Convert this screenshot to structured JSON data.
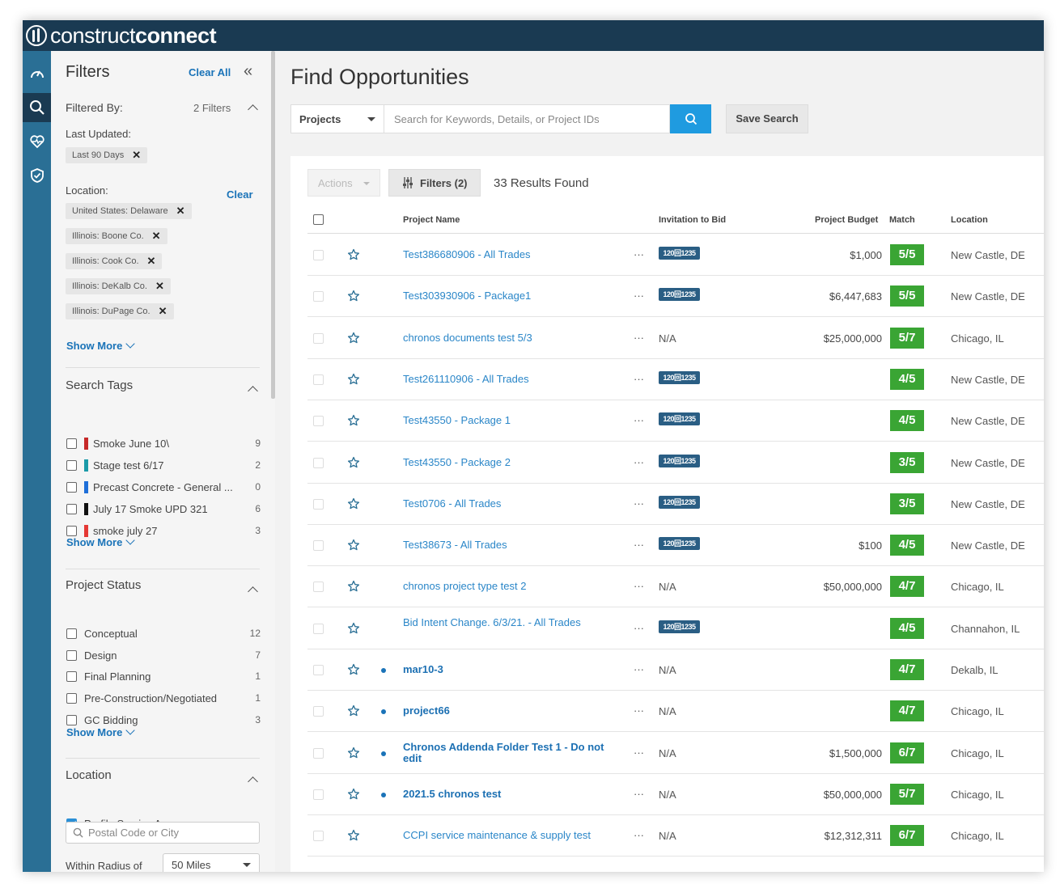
{
  "brand": {
    "part1": "construct",
    "part2": "connect"
  },
  "colors": {
    "topbar": "#1a3a52",
    "rail": "#2a6f95",
    "accent": "#1f9be0",
    "match": "#3aa534",
    "link": "#2a86c8"
  },
  "rail": [
    "dashboard-icon",
    "search-icon",
    "heart-pulse-icon",
    "shield-check-icon"
  ],
  "filters": {
    "title": "Filters",
    "clear_all": "Clear All",
    "filtered_by": "Filtered By:",
    "filter_count": "2 Filters",
    "last_updated_label": "Last Updated:",
    "last_updated_chip": "Last 90 Days",
    "location_label": "Location:",
    "location_clear": "Clear",
    "location_chips": [
      "United States: Delaware",
      "Illinois: Boone Co.",
      "Illinois: Cook Co.",
      "Illinois: DeKalb Co.",
      "Illinois: DuPage Co."
    ],
    "show_more": "Show More",
    "search_tags": {
      "title": "Search Tags",
      "items": [
        {
          "label": "Smoke June 10\\",
          "count": "9",
          "color": "#c62828"
        },
        {
          "label": "Stage test 6/17",
          "count": "2",
          "color": "#1a9aa8"
        },
        {
          "label": "Precast Concrete - General ...",
          "count": "0",
          "color": "#1e6fd9"
        },
        {
          "label": "July 17 Smoke UPD 321",
          "count": "6",
          "color": "#111111"
        },
        {
          "label": "smoke july 27",
          "count": "3",
          "color": "#e53935"
        }
      ]
    },
    "project_status": {
      "title": "Project Status",
      "items": [
        {
          "label": "Conceptual",
          "count": "12"
        },
        {
          "label": "Design",
          "count": "7"
        },
        {
          "label": "Final Planning",
          "count": "1"
        },
        {
          "label": "Pre-Construction/Negotiated",
          "count": "1"
        },
        {
          "label": "GC Bidding",
          "count": "3"
        }
      ]
    },
    "location_section": {
      "title": "Location",
      "profile_service_area": "Profile Service Area",
      "postal_placeholder": "Postal Code or City",
      "radius_label": "Within Radius of",
      "radius_value": "50 Miles"
    }
  },
  "main": {
    "title": "Find Opportunities",
    "project_type": "Projects",
    "search_placeholder": "Search for Keywords, Details, or Project IDs",
    "save_search": "Save Search",
    "actions": "Actions",
    "filters_button": "Filters (2)",
    "results_count": "33 Results Found",
    "columns": {
      "project_name": "Project Name",
      "itb": "Invitation to Bid",
      "budget": "Project Budget",
      "match": "Match",
      "location": "Location"
    },
    "more_glyph": "···",
    "itb_badge": "120回1235",
    "rows": [
      {
        "name": "Test386680906 - All Trades",
        "bold": false,
        "dot": false,
        "itb": "badge",
        "budget": "$1,000",
        "match": "5/5",
        "location": "New Castle, DE"
      },
      {
        "name": "Test303930906 - Package1",
        "bold": false,
        "dot": false,
        "itb": "badge",
        "budget": "$6,447,683",
        "match": "5/5",
        "location": "New Castle, DE"
      },
      {
        "name": "chronos documents test 5/3",
        "bold": false,
        "dot": false,
        "itb": "N/A",
        "budget": "$25,000,000",
        "match": "5/7",
        "location": "Chicago, IL"
      },
      {
        "name": "Test261110906 - All Trades",
        "bold": false,
        "dot": false,
        "itb": "badge",
        "budget": "",
        "match": "4/5",
        "location": "New Castle, DE"
      },
      {
        "name": "Test43550 - Package 1",
        "bold": false,
        "dot": false,
        "itb": "badge",
        "budget": "",
        "match": "4/5",
        "location": "New Castle, DE"
      },
      {
        "name": "Test43550 - Package 2",
        "bold": false,
        "dot": false,
        "itb": "badge",
        "budget": "",
        "match": "3/5",
        "location": "New Castle, DE"
      },
      {
        "name": "Test0706 - All Trades",
        "bold": false,
        "dot": false,
        "itb": "badge",
        "budget": "",
        "match": "3/5",
        "location": "New Castle, DE"
      },
      {
        "name": "Test38673 - All Trades",
        "bold": false,
        "dot": false,
        "itb": "badge",
        "budget": "$100",
        "match": "4/5",
        "location": "New Castle, DE"
      },
      {
        "name": "chronos project type test 2",
        "bold": false,
        "dot": false,
        "itb": "N/A",
        "budget": "$50,000,000",
        "match": "4/7",
        "location": "Chicago, IL"
      },
      {
        "name": "Bid Intent Change. 6/3/21. - All Trades",
        "bold": false,
        "dot": false,
        "itb": "badge",
        "budget": "",
        "match": "4/5",
        "location": "Channahon, IL"
      },
      {
        "name": "mar10-3",
        "bold": true,
        "dot": true,
        "itb": "N/A",
        "budget": "",
        "match": "4/7",
        "location": "Dekalb, IL"
      },
      {
        "name": "project66",
        "bold": true,
        "dot": true,
        "itb": "N/A",
        "budget": "",
        "match": "4/7",
        "location": "Chicago, IL"
      },
      {
        "name": "Chronos Addenda Folder Test 1 - Do not edit",
        "bold": true,
        "dot": true,
        "itb": "N/A",
        "budget": "$1,500,000",
        "match": "6/7",
        "location": "Chicago, IL"
      },
      {
        "name": "2021.5 chronos test",
        "bold": true,
        "dot": true,
        "itb": "N/A",
        "budget": "$50,000,000",
        "match": "5/7",
        "location": "Chicago, IL"
      },
      {
        "name": "CCPI service maintenance & supply test",
        "bold": false,
        "dot": false,
        "itb": "N/A",
        "budget": "$12,312,311",
        "match": "6/7",
        "location": "Chicago, IL"
      }
    ]
  }
}
